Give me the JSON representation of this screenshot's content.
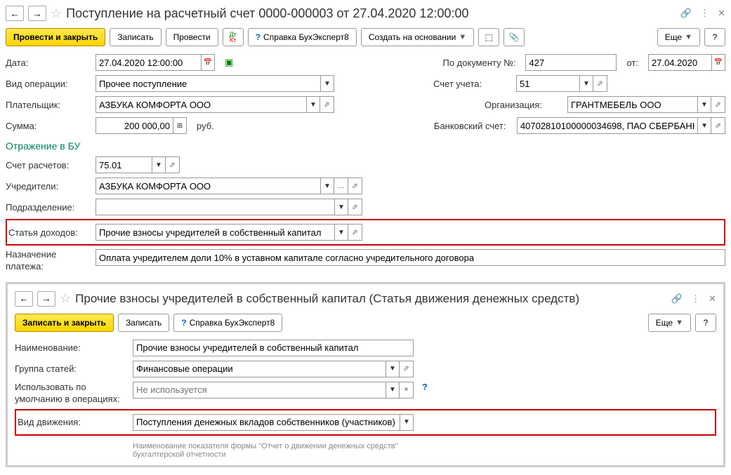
{
  "main": {
    "title": "Поступление на расчетный счет 0000-000003 от 27.04.2020 12:00:00",
    "toolbar": {
      "post_close": "Провести и закрыть",
      "save": "Записать",
      "post": "Провести",
      "help": "Справка БухЭксперт8",
      "create_based": "Создать на основании",
      "more": "Еще"
    },
    "fields": {
      "date_label": "Дата:",
      "date_value": "27.04.2020 12:00:00",
      "doc_num_label": "По документу №:",
      "doc_num_value": "427",
      "doc_date_label": "от:",
      "doc_date_value": "27.04.2020",
      "op_type_label": "Вид операции:",
      "op_type_value": "Прочее поступление",
      "account_label": "Счет учета:",
      "account_value": "51",
      "payer_label": "Плательщик:",
      "payer_value": "АЗБУКА КОМФОРТА ООО",
      "org_label": "Организация:",
      "org_value": "ГРАНТМЕБЕЛЬ ООО",
      "sum_label": "Сумма:",
      "sum_value": "200 000,00",
      "sum_currency": "руб.",
      "bank_label": "Банковский счет:",
      "bank_value": "40702810100000034698, ПАО СБЕРБАНК"
    },
    "bu_section": "Отражение в БУ",
    "bu": {
      "calc_account_label": "Счет расчетов:",
      "calc_account_value": "75.01",
      "founders_label": "Учредители:",
      "founders_value": "АЗБУКА КОМФОРТА ООО",
      "division_label": "Подразделение:",
      "division_value": "",
      "income_label": "Статья доходов:",
      "income_value": "Прочие взносы учредителей в собственный капитал",
      "purpose_label": "Назначение платежа:",
      "purpose_value": "Оплата учредителем доли 10% в уставном капитале согласно учредительного договора"
    }
  },
  "sub": {
    "title": "Прочие взносы учредителей в собственный капитал (Статья движения денежных средств)",
    "toolbar": {
      "save_close": "Записать и закрыть",
      "save": "Записать",
      "help": "Справка БухЭксперт8",
      "more": "Еще"
    },
    "fields": {
      "name_label": "Наименование:",
      "name_value": "Прочие взносы учредителей в собственный капитал",
      "group_label": "Группа статей:",
      "group_value": "Финансовые операции",
      "default_label1": "Использовать по",
      "default_label2": "умолчанию в операциях:",
      "default_placeholder": "Не используется",
      "movement_label": "Вид движения:",
      "movement_value": "Поступления денежных вкладов собственников (участников)",
      "hint": "Наименование показателя формы \"Отчет о движении денежных средств\" бухгалтерской отчетности"
    }
  }
}
